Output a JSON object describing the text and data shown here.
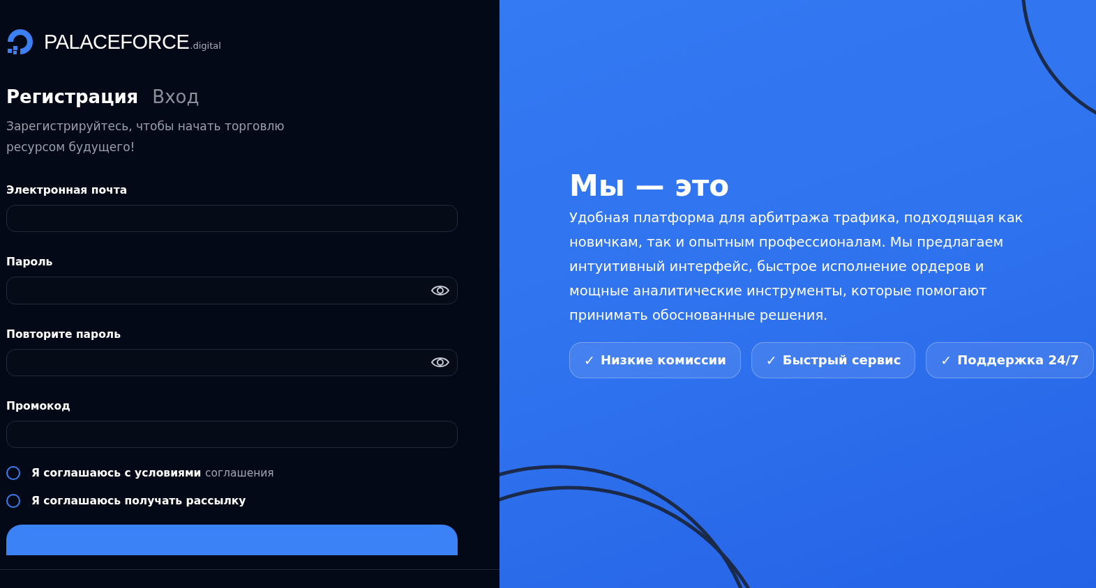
{
  "brand": {
    "name": "PALACEFORCE",
    "suffix": ".digital"
  },
  "tabs": [
    {
      "label": "Регистрация",
      "selected": true
    },
    {
      "label": "Вход",
      "selected": false
    }
  ],
  "subtitle": "Зарегистрируйтесь, чтобы начать торговлю ресурсом будущего!",
  "fields": [
    {
      "label": "Электронная почта",
      "kind": "text"
    },
    {
      "label": "Пароль",
      "kind": "password"
    },
    {
      "label": "Повторите пароль",
      "kind": "password"
    },
    {
      "label": "Промокод",
      "kind": "text"
    }
  ],
  "agreements": [
    {
      "text": "Я соглашаюсь с условиями",
      "link": "соглашения",
      "checked": false
    },
    {
      "text": "Я соглашаюсь получать рассылку",
      "checked": false
    }
  ],
  "hero": {
    "title": "Мы — это",
    "text": "Удобная платформа для арбитража трафика, подходящая как новичкам, так и опытным профессионалам. Мы предлагаем интуитивный интерфейс, быстрое исполнение ордеров и мощные аналитические инструменты, которые помогают принимать обоснованные решения.",
    "features": [
      {
        "check": "✓",
        "label": "Низкие комиссии"
      },
      {
        "check": "✓",
        "label": "Быстрый сервис"
      },
      {
        "check": "✓",
        "label": "Поддержка 24/7"
      }
    ]
  }
}
